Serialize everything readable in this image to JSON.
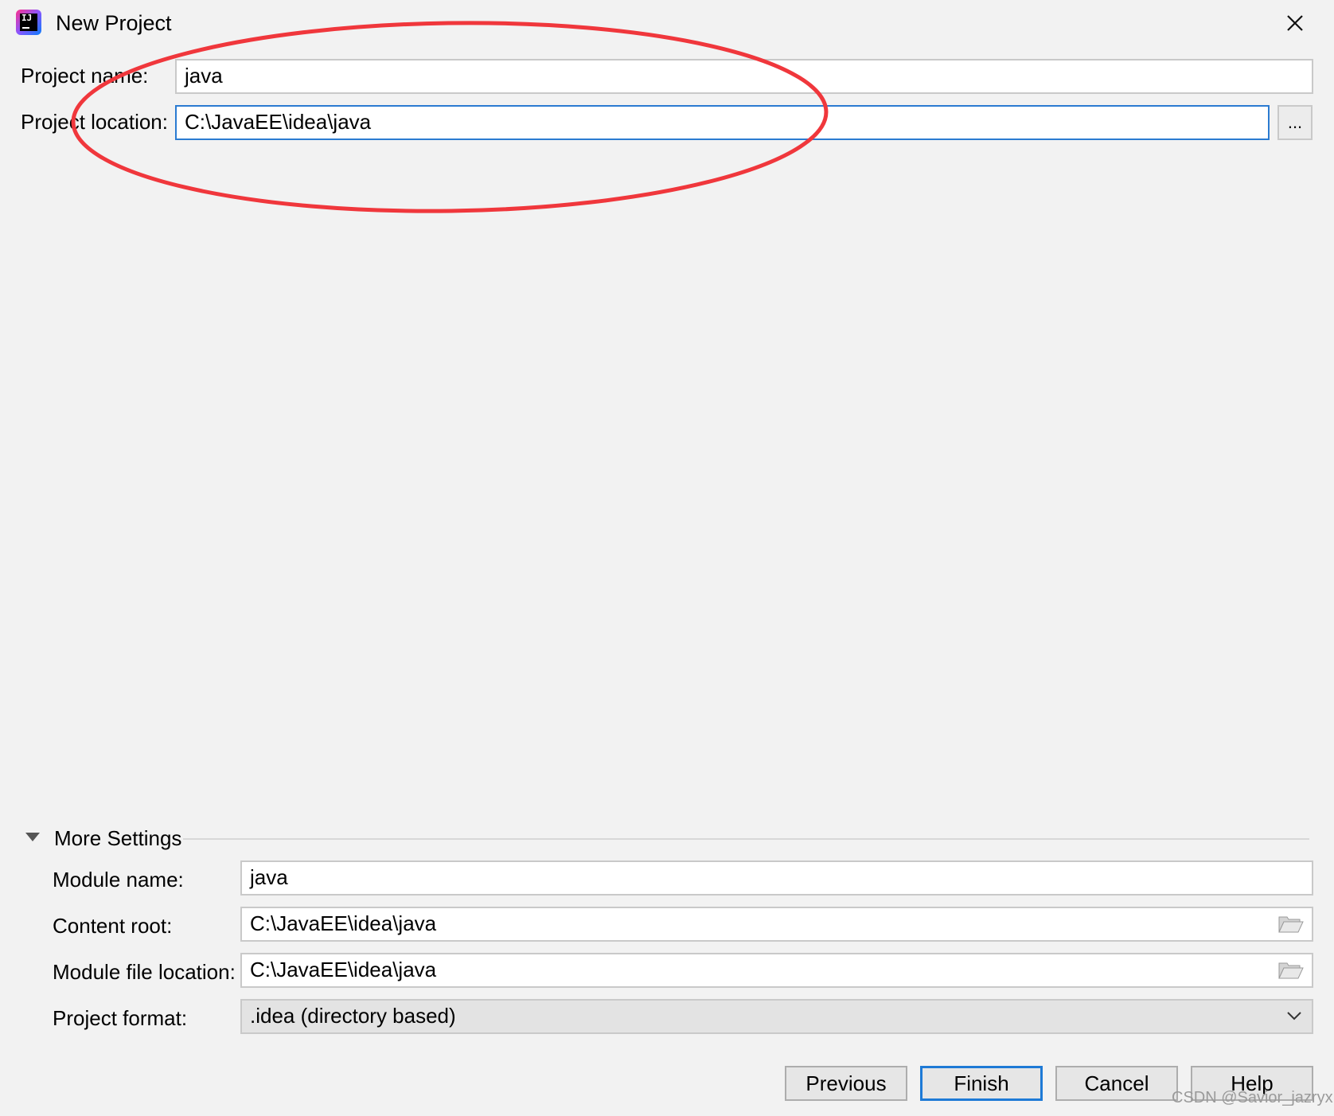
{
  "window": {
    "title": "New Project"
  },
  "form": {
    "project_name_label": "Project name:",
    "project_name_value": "java",
    "project_location_label": "Project location:",
    "project_location_value": "C:\\JavaEE\\idea\\java",
    "browse_label": "..."
  },
  "more_settings": {
    "header": "More Settings",
    "module_name_label": "Module name:",
    "module_name_value": "java",
    "content_root_label": "Content root:",
    "content_root_value": "C:\\JavaEE\\idea\\java",
    "module_file_location_label": "Module file location:",
    "module_file_location_value": "C:\\JavaEE\\idea\\java",
    "project_format_label": "Project format:",
    "project_format_value": ".idea (directory based)"
  },
  "buttons": {
    "previous": "Previous",
    "finish": "Finish",
    "cancel": "Cancel",
    "help": "Help"
  },
  "watermark": "CSDN @Savior_jazryx",
  "colors": {
    "background": "#f2f2f2",
    "focus_border": "#2b7bd1",
    "annotation": "#f0373c"
  }
}
